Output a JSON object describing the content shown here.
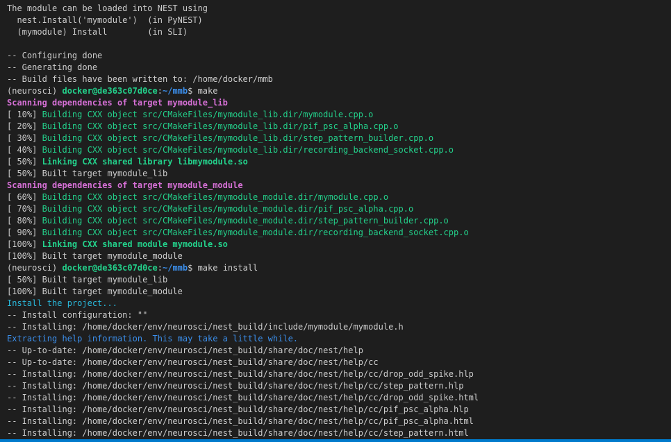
{
  "terminal": {
    "lines": [
      {
        "segments": [
          {
            "text": "The module can be loaded into NEST using",
            "color": "default"
          }
        ]
      },
      {
        "segments": [
          {
            "text": "  nest.Install('mymodule')  (in PyNEST)",
            "color": "default"
          }
        ]
      },
      {
        "segments": [
          {
            "text": "  (mymodule) Install        (in SLI)",
            "color": "default"
          }
        ]
      },
      {
        "segments": [
          {
            "text": "",
            "color": "default"
          }
        ]
      },
      {
        "segments": [
          {
            "text": "-- Configuring done",
            "color": "default"
          }
        ]
      },
      {
        "segments": [
          {
            "text": "-- Generating done",
            "color": "default"
          }
        ]
      },
      {
        "segments": [
          {
            "text": "-- Build files have been written to: /home/docker/mmb",
            "color": "default"
          }
        ]
      },
      {
        "segments": [
          {
            "text": "(neurosci) ",
            "color": "default"
          },
          {
            "text": "docker@de363c07d0ce",
            "color": "prompt-user"
          },
          {
            "text": ":",
            "color": "default"
          },
          {
            "text": "~/mmb",
            "color": "prompt-path"
          },
          {
            "text": "$ make",
            "color": "default"
          }
        ]
      },
      {
        "segments": [
          {
            "text": "Scanning dependencies of target mymodule_lib",
            "color": "magenta-bold"
          }
        ]
      },
      {
        "segments": [
          {
            "text": "[ 10%] ",
            "color": "default"
          },
          {
            "text": "Building CXX object src/CMakeFiles/mymodule_lib.dir/mymodule.cpp.o",
            "color": "green"
          }
        ]
      },
      {
        "segments": [
          {
            "text": "[ 20%] ",
            "color": "default"
          },
          {
            "text": "Building CXX object src/CMakeFiles/mymodule_lib.dir/pif_psc_alpha.cpp.o",
            "color": "green"
          }
        ]
      },
      {
        "segments": [
          {
            "text": "[ 30%] ",
            "color": "default"
          },
          {
            "text": "Building CXX object src/CMakeFiles/mymodule_lib.dir/step_pattern_builder.cpp.o",
            "color": "green"
          }
        ]
      },
      {
        "segments": [
          {
            "text": "[ 40%] ",
            "color": "default"
          },
          {
            "text": "Building CXX object src/CMakeFiles/mymodule_lib.dir/recording_backend_socket.cpp.o",
            "color": "green"
          }
        ]
      },
      {
        "segments": [
          {
            "text": "[ 50%] ",
            "color": "default"
          },
          {
            "text": "Linking CXX shared library libmymodule.so",
            "color": "green-bold"
          }
        ]
      },
      {
        "segments": [
          {
            "text": "[ 50%] Built target mymodule_lib",
            "color": "default"
          }
        ]
      },
      {
        "segments": [
          {
            "text": "Scanning dependencies of target mymodule_module",
            "color": "magenta-bold"
          }
        ]
      },
      {
        "segments": [
          {
            "text": "[ 60%] ",
            "color": "default"
          },
          {
            "text": "Building CXX object src/CMakeFiles/mymodule_module.dir/mymodule.cpp.o",
            "color": "green"
          }
        ]
      },
      {
        "segments": [
          {
            "text": "[ 70%] ",
            "color": "default"
          },
          {
            "text": "Building CXX object src/CMakeFiles/mymodule_module.dir/pif_psc_alpha.cpp.o",
            "color": "green"
          }
        ]
      },
      {
        "segments": [
          {
            "text": "[ 80%] ",
            "color": "default"
          },
          {
            "text": "Building CXX object src/CMakeFiles/mymodule_module.dir/step_pattern_builder.cpp.o",
            "color": "green"
          }
        ]
      },
      {
        "segments": [
          {
            "text": "[ 90%] ",
            "color": "default"
          },
          {
            "text": "Building CXX object src/CMakeFiles/mymodule_module.dir/recording_backend_socket.cpp.o",
            "color": "green"
          }
        ]
      },
      {
        "segments": [
          {
            "text": "[100%] ",
            "color": "default"
          },
          {
            "text": "Linking CXX shared module mymodule.so",
            "color": "green-bold"
          }
        ]
      },
      {
        "segments": [
          {
            "text": "[100%] Built target mymodule_module",
            "color": "default"
          }
        ]
      },
      {
        "segments": [
          {
            "text": "(neurosci) ",
            "color": "default"
          },
          {
            "text": "docker@de363c07d0ce",
            "color": "prompt-user"
          },
          {
            "text": ":",
            "color": "default"
          },
          {
            "text": "~/mmb",
            "color": "prompt-path"
          },
          {
            "text": "$ make install",
            "color": "default"
          }
        ]
      },
      {
        "segments": [
          {
            "text": "[ 50%] Built target mymodule_lib",
            "color": "default"
          }
        ]
      },
      {
        "segments": [
          {
            "text": "[100%] Built target mymodule_module",
            "color": "default"
          }
        ]
      },
      {
        "segments": [
          {
            "text": "Install the project...",
            "color": "cyan"
          }
        ]
      },
      {
        "segments": [
          {
            "text": "-- Install configuration: \"\"",
            "color": "default"
          }
        ]
      },
      {
        "segments": [
          {
            "text": "-- Installing: /home/docker/env/neurosci/nest_build/include/mymodule/mymodule.h",
            "color": "default"
          }
        ]
      },
      {
        "segments": [
          {
            "text": "Extracting help information. This may take a little while.",
            "color": "blue"
          }
        ]
      },
      {
        "segments": [
          {
            "text": "-- Up-to-date: /home/docker/env/neurosci/nest_build/share/doc/nest/help",
            "color": "default"
          }
        ]
      },
      {
        "segments": [
          {
            "text": "-- Up-to-date: /home/docker/env/neurosci/nest_build/share/doc/nest/help/cc",
            "color": "default"
          }
        ]
      },
      {
        "segments": [
          {
            "text": "-- Installing: /home/docker/env/neurosci/nest_build/share/doc/nest/help/cc/drop_odd_spike.hlp",
            "color": "default"
          }
        ]
      },
      {
        "segments": [
          {
            "text": "-- Installing: /home/docker/env/neurosci/nest_build/share/doc/nest/help/cc/step_pattern.hlp",
            "color": "default"
          }
        ]
      },
      {
        "segments": [
          {
            "text": "-- Installing: /home/docker/env/neurosci/nest_build/share/doc/nest/help/cc/drop_odd_spike.html",
            "color": "default"
          }
        ]
      },
      {
        "segments": [
          {
            "text": "-- Installing: /home/docker/env/neurosci/nest_build/share/doc/nest/help/cc/pif_psc_alpha.hlp",
            "color": "default"
          }
        ]
      },
      {
        "segments": [
          {
            "text": "-- Installing: /home/docker/env/neurosci/nest_build/share/doc/nest/help/cc/pif_psc_alpha.html",
            "color": "default"
          }
        ]
      },
      {
        "segments": [
          {
            "text": "-- Installing: /home/docker/env/neurosci/nest_build/share/doc/nest/help/cc/step_pattern.html",
            "color": "default"
          }
        ]
      }
    ]
  },
  "colors": {
    "background": "#1e1e1e",
    "default": "#cccccc",
    "green": "#23d18b",
    "magenta": "#d670d6",
    "cyan": "#29b8db",
    "blue": "#3b8eea",
    "status_bar": "#007acc"
  }
}
